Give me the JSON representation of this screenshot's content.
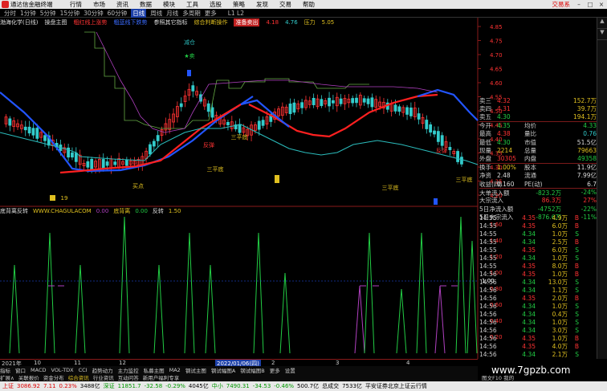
{
  "menubar": {
    "app_title": "通达信金融终端",
    "items": [
      "行情",
      "市场",
      "资讯",
      "数据",
      "模块",
      "工具",
      "选股",
      "策略",
      "发现",
      "交易",
      "帮助"
    ],
    "trade_link": "交易系",
    "win_min": "–",
    "win_max": "□",
    "win_close": "×"
  },
  "periodbar": {
    "periods": [
      "分时",
      "1分钟",
      "5分钟",
      "15分钟",
      "30分钟",
      "60分钟",
      "日线",
      "周线",
      "月线",
      "多周期",
      "更多"
    ],
    "active": "日线",
    "extra": "L1 L2"
  },
  "main_title": {
    "stock": "渤海化学(日线)",
    "indicator": "操盘主图",
    "item1": "粗红线上涨势",
    "item2": "粗蓝线下跌势",
    "item3": "参照其它指标",
    "item4": "综合判断操作",
    "item5": "准备卖出",
    "item5_val": "4.18",
    "item6_val": "4.76",
    "item7": "压力",
    "item7_val": "5.05"
  },
  "price_axis": [
    "4.85",
    "4.75",
    "4.70",
    "4.65",
    "4.60",
    "4.55",
    "4.50",
    "4.45",
    "4.40",
    "4.35",
    "4.30",
    "4.25",
    "4.20"
  ],
  "chart_labels": {
    "sell": "减仓",
    "buy_star": "★卖",
    "s1": "三平底",
    "s2": "三平底",
    "s3": "三平底",
    "s4": "三平底",
    "low": "19",
    "bottom": "底部",
    "rebound": "反弹",
    "rebound2": "反弹",
    "first": "买点"
  },
  "indicator": {
    "title": "底背离反转",
    "url": "WWW.CHAGULACOM",
    "v1": "0.00",
    "name": "底背离",
    "v2": "0.00",
    "label": "反转",
    "v3": "1.50",
    "axis": [
      "1.60",
      "1.40",
      "1.20",
      "1.00",
      "0.80",
      "0.60",
      "0.40",
      "0.20"
    ],
    "current": "1.00"
  },
  "quote": {
    "rows": [
      {
        "a": "卖三",
        "b": "4.32",
        "c": "",
        "d": "152.7万",
        "cb": "up",
        "cd": "yl"
      },
      {
        "a": "卖四",
        "b": "4.31",
        "c": "",
        "d": "39.7万",
        "cb": "up",
        "cd": "yl"
      },
      {
        "a": "卖五",
        "b": "4.30",
        "c": "",
        "d": "194.1万",
        "cb": "dn",
        "cd": "yl"
      },
      {
        "a": "今开",
        "b": "4.35",
        "c": "均价",
        "d": "4.33",
        "cb": "dn",
        "cd": "dn"
      },
      {
        "a": "最高",
        "b": "4.38",
        "c": "量比",
        "d": "0.76",
        "cb": "up",
        "cd": "cy"
      },
      {
        "a": "最低",
        "b": "4.30",
        "c": "市值",
        "d": "51.5亿",
        "cb": "dn",
        "cd": "wt"
      },
      {
        "a": "现量",
        "b": "2214",
        "c": "总量",
        "d": "79663",
        "cb": "yl",
        "cd": "yl"
      },
      {
        "a": "外盘",
        "b": "30305",
        "c": "内盘",
        "d": "49358",
        "cb": "up",
        "cd": "dn"
      },
      {
        "a": "换手",
        "b": "1.00%",
        "c": "股本",
        "d": "11.9亿",
        "cb": "yl",
        "cd": "wt"
      },
      {
        "a": "净资",
        "b": "2.48",
        "c": "流通",
        "d": "7.99亿",
        "cb": "wt",
        "cd": "wt"
      },
      {
        "a": "收益(四)",
        "b": "0.160",
        "c": "PE(动)",
        "d": "6.7",
        "cb": "wt",
        "cd": "wt"
      }
    ],
    "flows": [
      {
        "a": "大单流入额",
        "b": "-823.2万",
        "c": "-24%",
        "cb": "dn",
        "cc": "dn"
      },
      {
        "a": "大宗流入",
        "b": "86.3万",
        "c": "27%",
        "cb": "up",
        "cc": "up"
      },
      {
        "a": "5日净流入额",
        "b": "-4752万",
        "c": "-22%",
        "cb": "dn",
        "cc": "dn"
      },
      {
        "a": "5日大宗流入",
        "b": "-876.6万",
        "c": "-11%",
        "cb": "dn",
        "cc": "dn"
      }
    ]
  },
  "ticks": [
    {
      "t": "14:55",
      "p": "4.35",
      "v": "4.9万",
      "s": "B",
      "c": "up"
    },
    {
      "t": "14:55",
      "p": "4.35",
      "v": "6.0万",
      "s": "B",
      "c": "up"
    },
    {
      "t": "14:55",
      "p": "4.34",
      "v": "1.0万",
      "s": "S",
      "c": "dn"
    },
    {
      "t": "14:55",
      "p": "4.34",
      "v": "2.5万",
      "s": "B",
      "c": "dn"
    },
    {
      "t": "14:55",
      "p": "4.35",
      "v": "6.0万",
      "s": "S",
      "c": "up"
    },
    {
      "t": "14:55",
      "p": "4.34",
      "v": "1.0万",
      "s": "S",
      "c": "dn"
    },
    {
      "t": "14:55",
      "p": "4.35",
      "v": "8.0万",
      "s": "B",
      "c": "up"
    },
    {
      "t": "14:56",
      "p": "4.35",
      "v": "1.0万",
      "s": "B",
      "c": "up"
    },
    {
      "t": "14:56",
      "p": "4.34",
      "v": "13.0万",
      "s": "S",
      "c": "dn"
    },
    {
      "t": "14:56",
      "p": "4.34",
      "v": "1.1万",
      "s": "S",
      "c": "dn"
    },
    {
      "t": "14:56",
      "p": "4.35",
      "v": "2.0万",
      "s": "B",
      "c": "up"
    },
    {
      "t": "14:56",
      "p": "4.34",
      "v": "1.0万",
      "s": "S",
      "c": "dn"
    },
    {
      "t": "14:56",
      "p": "4.34",
      "v": "0.4万",
      "s": "S",
      "c": "dn"
    },
    {
      "t": "14:56",
      "p": "4.34",
      "v": "1.0万",
      "s": "S",
      "c": "dn"
    },
    {
      "t": "14:56",
      "p": "4.34",
      "v": "3.0万",
      "s": "S",
      "c": "dn"
    },
    {
      "t": "14:56",
      "p": "4.35",
      "v": "1.0万",
      "s": "B",
      "c": "up"
    },
    {
      "t": "14:56",
      "p": "4.35",
      "v": "4.0万",
      "s": "B",
      "c": "up"
    },
    {
      "t": "14:56",
      "p": "4.34",
      "v": "2.1万",
      "s": "S",
      "c": "dn"
    }
  ],
  "timebar": {
    "year": "2021年",
    "months": [
      "10",
      "11",
      "12",
      "2022/01/06(四)",
      "2",
      "3",
      "4"
    ],
    "selected": "2022/01/06(四)"
  },
  "tabs": [
    "指标",
    "窗口",
    "MACD",
    "VOL-TDX",
    "CCI",
    "趋势动力",
    "主力监控",
    "私募主图",
    "MA2",
    "钢试主图",
    "钢试幅图A",
    "钢试幅图B",
    "更多",
    "设置"
  ],
  "tabs2": {
    "items": [
      "扩展∧",
      "关联报价",
      "资金分布",
      "综合资讯",
      "行业资讯",
      "互动问答",
      "新用户福利专享"
    ],
    "hl": "综合资讯"
  },
  "statusbar": {
    "sh": "上证",
    "sh_val": "3086.92",
    "sh_chg": "7.11",
    "sh_pct": "0.23%",
    "sh_amt": "3488亿",
    "sz": "深证",
    "sz_val": "11851.7",
    "sz_chg": "-32.58",
    "sz_pct": "-0.29%",
    "sz_amt": "4045亿",
    "cy": "中小",
    "cy_val": "7490.31",
    "cy_chg": "-34.53",
    "cy_pct": "-0.46%",
    "cy_amt": "500.7亿",
    "total": "总成交",
    "total_val": "7533亿",
    "news": "平安证券北京上证云行情"
  },
  "footer_note": "图文F10 我的",
  "watermark": "www.7gpzb.com",
  "colors": {
    "up": "#ff3333",
    "down": "#22cc44",
    "ma_red": "#ff2020",
    "ma_blue": "#2255ff",
    "line_cyan": "#2bbcbc",
    "line_green": "#66aa44",
    "line_purple": "#b040c0"
  }
}
